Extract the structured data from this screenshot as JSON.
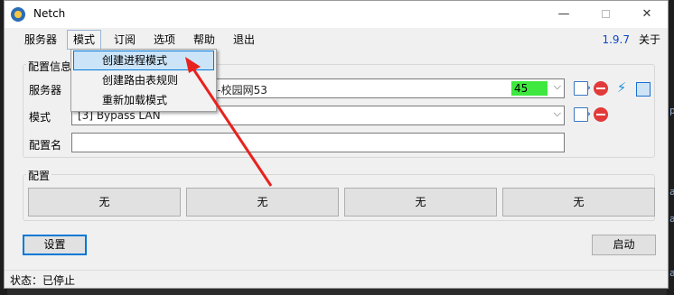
{
  "window": {
    "title": "Netch"
  },
  "menubar": {
    "items": [
      "服务器",
      "模式",
      "订阅",
      "选项",
      "帮助",
      "退出"
    ],
    "version": "1.9.7",
    "about": "关于"
  },
  "config_info": {
    "group_title": "配置信息",
    "server_label": "服务器",
    "server_value": "s-校园网53",
    "latency": "45",
    "mode_label": "模式",
    "mode_value": "[3] Bypass LAN",
    "profile_label": "配置名",
    "profile_value": ""
  },
  "profiles": {
    "group_title": "配置",
    "buttons": [
      "无",
      "无",
      "无",
      "无"
    ]
  },
  "actions": {
    "settings": "设置",
    "start": "启动"
  },
  "status": {
    "text": "状态：已停止"
  },
  "mode_menu": {
    "items": [
      "创建进程模式",
      "创建路由表规则",
      "重新加载模式"
    ],
    "highlighted_index": 0
  },
  "colors": {
    "accent": "#0078d7",
    "latency_good": "#3ee83e",
    "version_link": "#0b46c9",
    "annotation_arrow": "#e8221e"
  },
  "background_glyphs": [
    "p",
    "a",
    "a",
    "a"
  ]
}
